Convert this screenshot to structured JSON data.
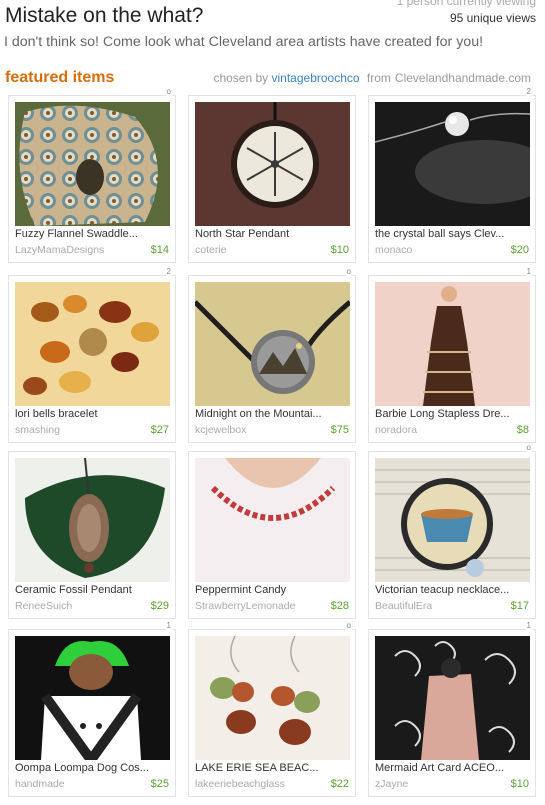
{
  "viewers": {
    "current": "1 person currently viewing",
    "unique": "95 unique views"
  },
  "header": {
    "title": "Mistake on the what?",
    "subtitle": "I don't think so! Come look what Cleveland area artists have created for you!"
  },
  "featured": {
    "heading": "featured items",
    "chosen_by_label": "chosen by",
    "curator": "vintagebroochco",
    "from_label": "from",
    "source": "Clevelandhandmade.com"
  },
  "items": [
    {
      "rank": "o",
      "title": "Fuzzy Flannel Swaddle...",
      "shop": "LazyMamaDesigns",
      "price": "$14",
      "image": "flannel-swaddle"
    },
    {
      "rank": "",
      "title": "North Star Pendant",
      "shop": "coterie",
      "price": "$10",
      "image": "star-pendant"
    },
    {
      "rank": "2",
      "title": "the crystal ball says Clev...",
      "shop": "monaco",
      "price": "$20",
      "image": "crystal-ball-necklace"
    },
    {
      "rank": "2",
      "title": "lori bells bracelet",
      "shop": "smashing",
      "price": "$27",
      "image": "bead-bracelet"
    },
    {
      "rank": "o",
      "title": "Midnight on the Mountai...",
      "shop": "kcjewelbox",
      "price": "$75",
      "image": "mountain-pendant"
    },
    {
      "rank": "1",
      "title": "Barbie Long Stapless Dre...",
      "shop": "noradora",
      "price": "$8",
      "image": "barbie-dress"
    },
    {
      "rank": "",
      "title": "Ceramic Fossil Pendant",
      "shop": "ReneeSuich",
      "price": "$29",
      "image": "fossil-pendant"
    },
    {
      "rank": "",
      "title": "Peppermint Candy",
      "shop": "StrawberryLemonade",
      "price": "$28",
      "image": "candy-necklace"
    },
    {
      "rank": "o",
      "title": "Victorian teacup necklace...",
      "shop": "BeautifulEra",
      "price": "$17",
      "image": "teacup-necklace"
    },
    {
      "rank": "1",
      "title": "Oompa Loompa Dog Cos...",
      "shop": "handmade",
      "price": "$25",
      "image": "dog-costume"
    },
    {
      "rank": "o",
      "title": "LAKE ERIE SEA BEAC...",
      "shop": "lakeeriebeachglass",
      "price": "$22",
      "image": "sea-glass-earrings"
    },
    {
      "rank": "1",
      "title": "Mermaid Art Card ACEO...",
      "shop": "zJayne",
      "price": "$10",
      "image": "mermaid-art-card"
    }
  ]
}
